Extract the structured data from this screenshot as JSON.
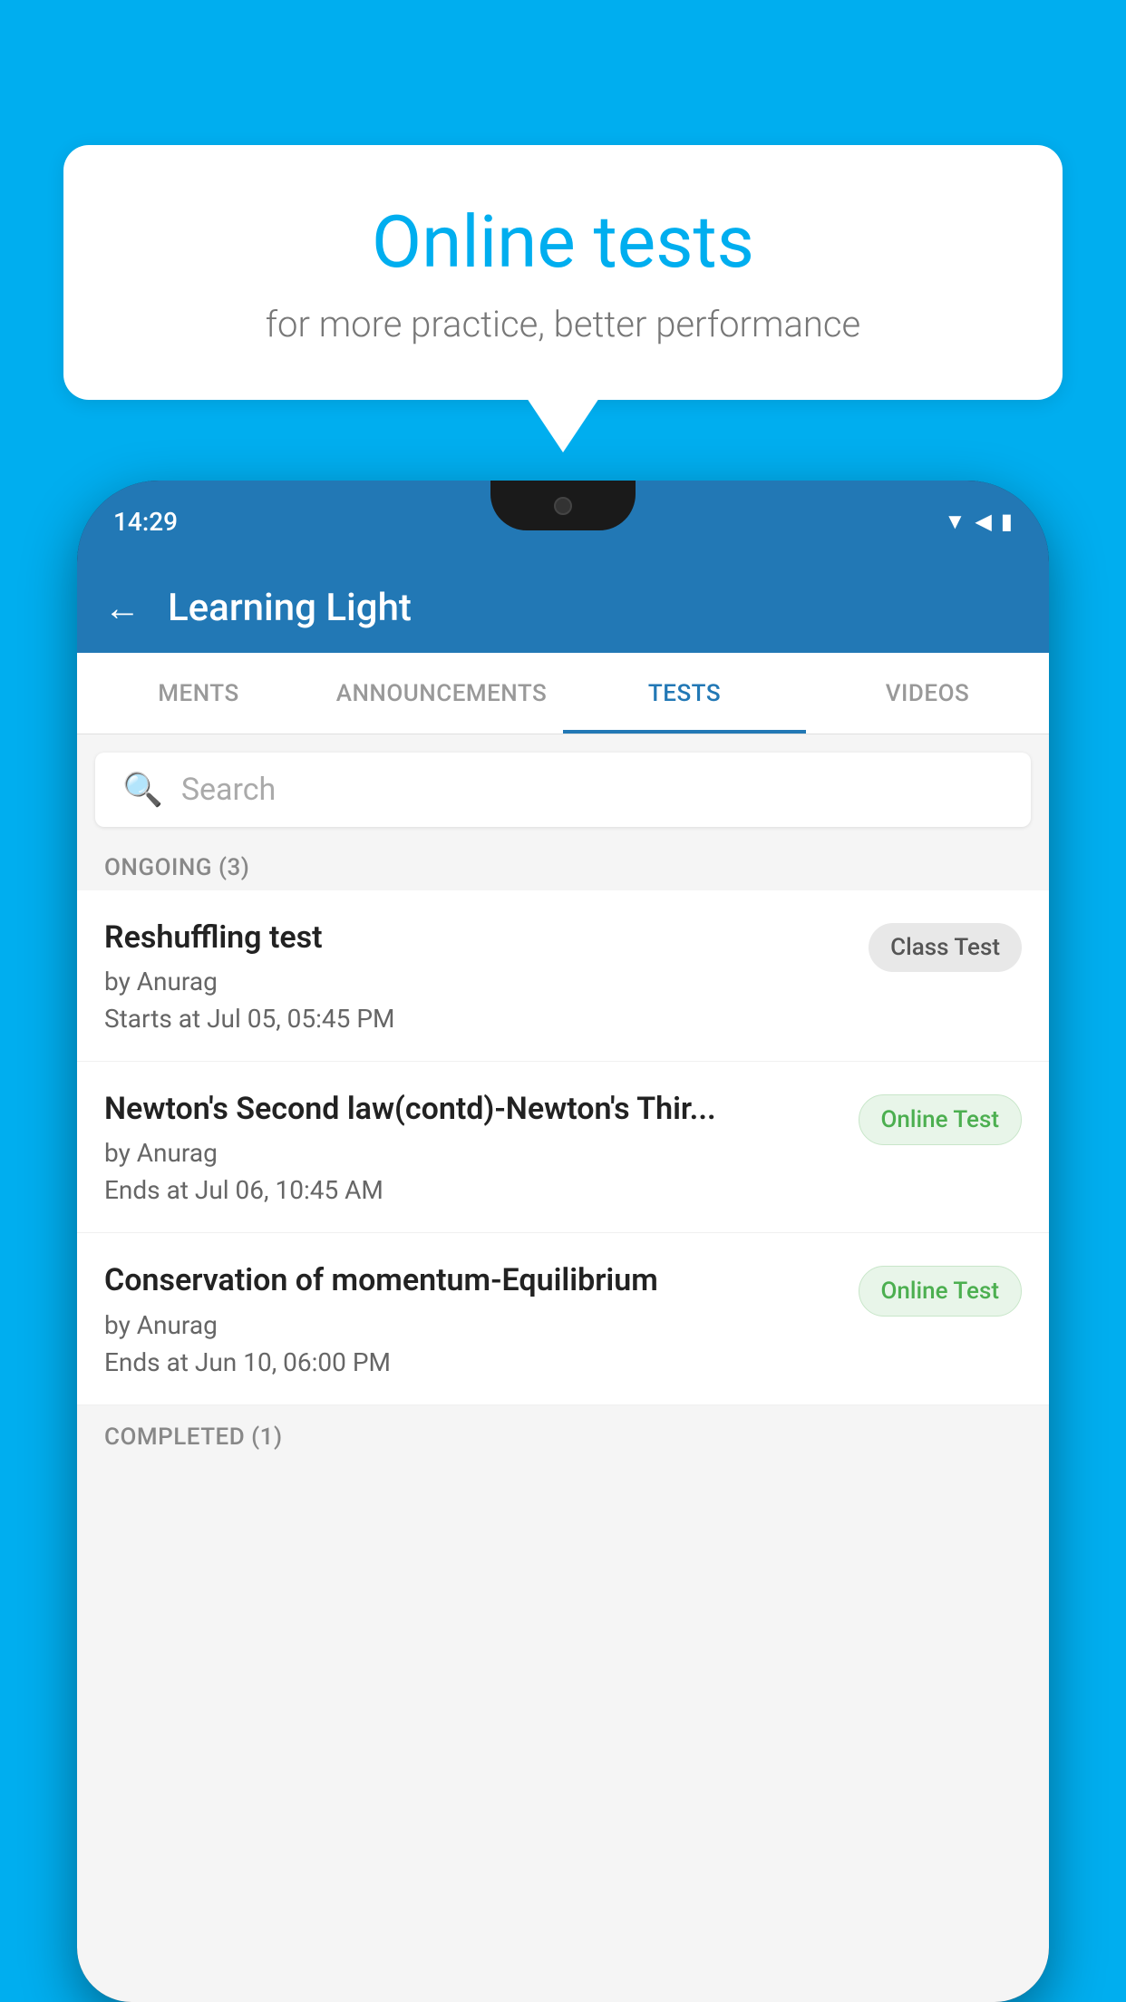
{
  "background": {
    "color": "#00AEEF"
  },
  "speech_bubble": {
    "title": "Online tests",
    "subtitle": "for more practice, better performance"
  },
  "phone": {
    "status_bar": {
      "time": "14:29"
    },
    "app_header": {
      "title": "Learning Light",
      "back_label": "←"
    },
    "tabs": [
      {
        "id": "ments",
        "label": "MENTS",
        "active": false
      },
      {
        "id": "announcements",
        "label": "ANNOUNCEMENTS",
        "active": false
      },
      {
        "id": "tests",
        "label": "TESTS",
        "active": true
      },
      {
        "id": "videos",
        "label": "VIDEOS",
        "active": false
      }
    ],
    "search": {
      "placeholder": "Search"
    },
    "sections": [
      {
        "id": "ongoing",
        "header": "ONGOING (3)",
        "items": [
          {
            "id": "test-1",
            "name": "Reshuffling test",
            "author": "by Anurag",
            "time_label": "Starts at",
            "time": "Jul 05, 05:45 PM",
            "badge": "Class Test",
            "badge_type": "class"
          },
          {
            "id": "test-2",
            "name": "Newton's Second law(contd)-Newton's Thir...",
            "author": "by Anurag",
            "time_label": "Ends at",
            "time": "Jul 06, 10:45 AM",
            "badge": "Online Test",
            "badge_type": "online"
          },
          {
            "id": "test-3",
            "name": "Conservation of momentum-Equilibrium",
            "author": "by Anurag",
            "time_label": "Ends at",
            "time": "Jun 10, 06:00 PM",
            "badge": "Online Test",
            "badge_type": "online"
          }
        ]
      }
    ],
    "completed_section_label": "COMPLETED (1)"
  }
}
